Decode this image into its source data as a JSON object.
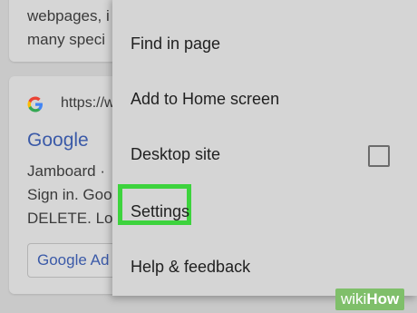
{
  "background": {
    "top_card": {
      "lines": [
        "webpages, i",
        "many speci"
      ]
    },
    "result": {
      "favicon": "G",
      "url": "https://w",
      "title": "Google",
      "snippet_lines": [
        "Jamboard ·",
        "Sign in. Goo",
        "DELETE. Lo"
      ],
      "sub_link": "Google Ad"
    }
  },
  "menu": {
    "items": [
      {
        "label": "Find in page"
      },
      {
        "label": "Add to Home screen"
      },
      {
        "label": "Desktop site",
        "checkbox_checked": false
      },
      {
        "label": "Settings",
        "highlighted": true
      },
      {
        "label": "Help & feedback"
      }
    ]
  },
  "watermark": {
    "part1": "wiki",
    "part2": "How"
  },
  "colors": {
    "highlight": "#3dd33d",
    "link": "#3b5aa8",
    "menu_bg": "#d5d5d5",
    "page_bg": "#c9c9c9"
  }
}
